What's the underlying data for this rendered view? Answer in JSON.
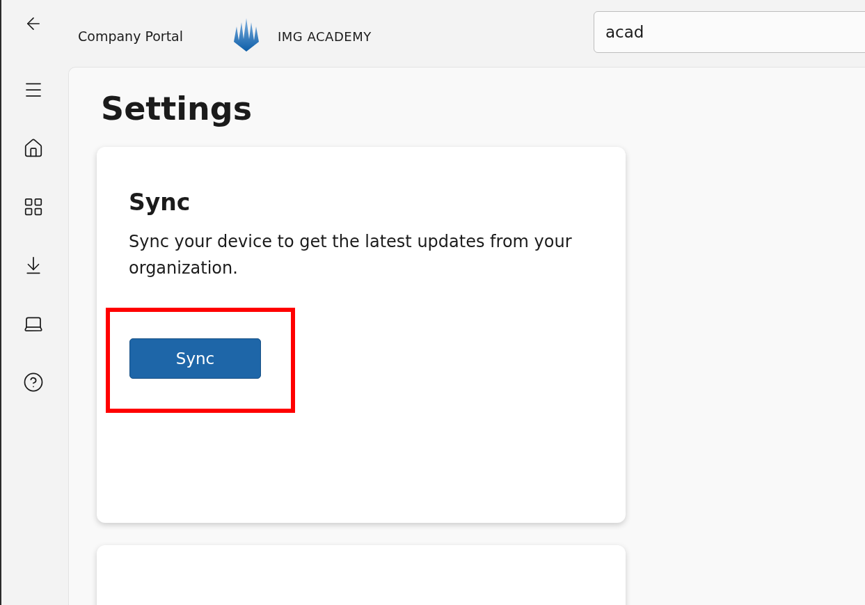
{
  "header": {
    "app_title": "Company Portal",
    "org_name": "IMG ACADEMY",
    "search": {
      "value": "acad"
    }
  },
  "sidebar": {
    "items": [
      {
        "kind": "menu",
        "selected": false
      },
      {
        "kind": "home",
        "selected": false
      },
      {
        "kind": "apps",
        "selected": false
      },
      {
        "kind": "downloads",
        "selected": false
      },
      {
        "kind": "devices",
        "selected": false
      },
      {
        "kind": "help",
        "selected": false
      }
    ]
  },
  "page": {
    "title": "Settings",
    "sync_card": {
      "heading": "Sync",
      "description": "Sync your device to get the latest updates from your organization.",
      "button": {
        "label": "Sync",
        "highlighted": true
      }
    }
  }
}
